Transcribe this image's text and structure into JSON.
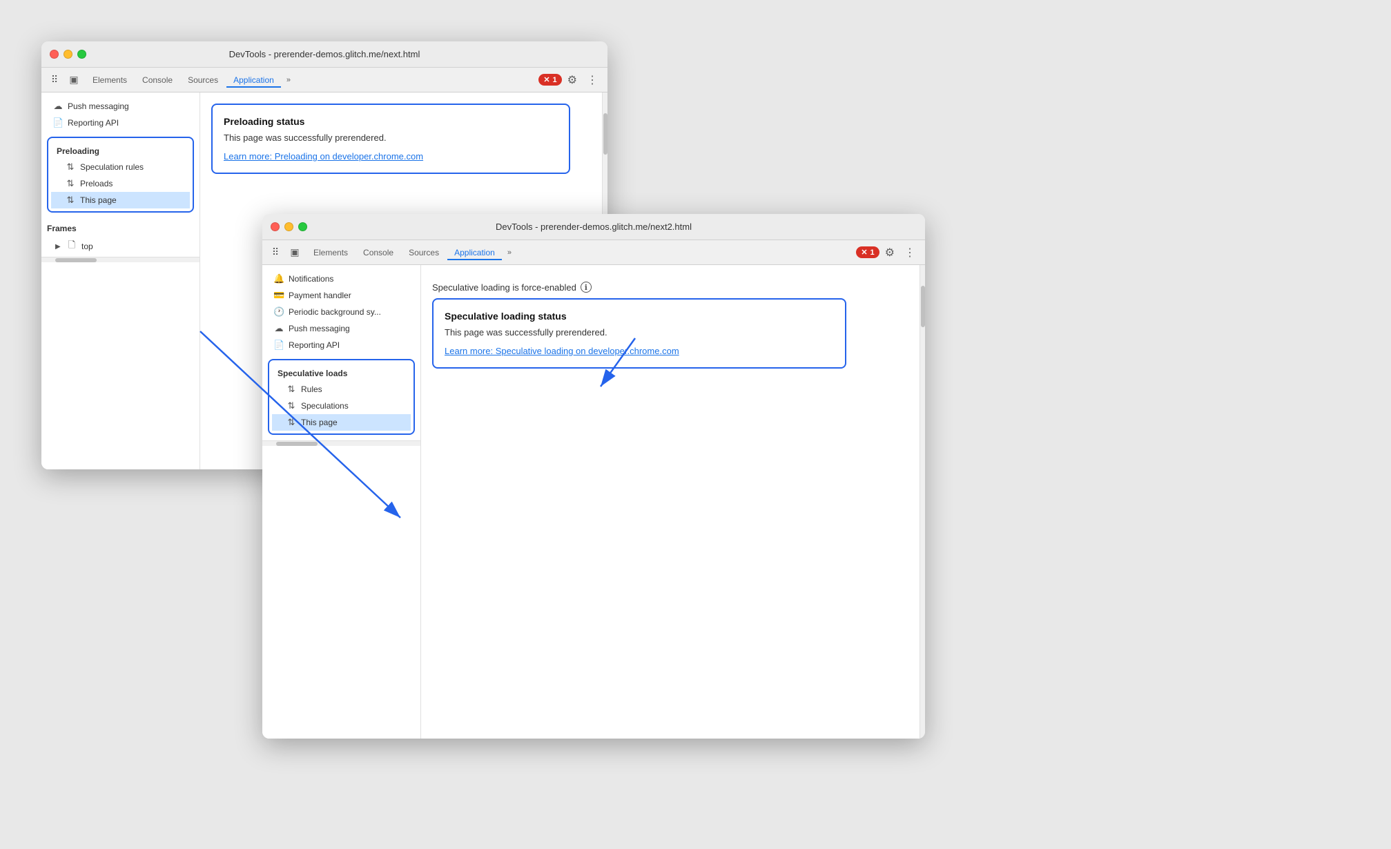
{
  "window1": {
    "title": "DevTools - prerender-demos.glitch.me/next.html",
    "tabs": [
      "Elements",
      "Console",
      "Sources",
      "Application"
    ],
    "active_tab": "Application",
    "error_count": "1",
    "sidebar": {
      "groups": [
        {
          "label": null,
          "items": [
            {
              "icon": "☁",
              "label": "Push messaging"
            },
            {
              "icon": "📄",
              "label": "Reporting API"
            }
          ]
        },
        {
          "label": "Preloading",
          "items": [
            {
              "icon": "↑↓",
              "label": "Speculation rules"
            },
            {
              "icon": "↑↓",
              "label": "Preloads"
            },
            {
              "icon": "↑↓",
              "label": "This page",
              "selected": true
            }
          ]
        },
        {
          "label": "Frames",
          "items": [
            {
              "icon": "▶",
              "label": "top",
              "indent": true
            }
          ]
        }
      ]
    },
    "main": {
      "box_title": "Preloading status",
      "box_text": "This page was successfully prerendered.",
      "box_link": "Learn more: Preloading on developer.chrome.com"
    }
  },
  "window2": {
    "title": "DevTools - prerender-demos.glitch.me/next2.html",
    "tabs": [
      "Elements",
      "Console",
      "Sources",
      "Application"
    ],
    "active_tab": "Application",
    "error_count": "1",
    "sidebar": {
      "items": [
        {
          "icon": "🔔",
          "label": "Notifications"
        },
        {
          "icon": "💳",
          "label": "Payment handler"
        },
        {
          "icon": "🕐",
          "label": "Periodic background sy..."
        },
        {
          "icon": "☁",
          "label": "Push messaging"
        },
        {
          "icon": "📄",
          "label": "Reporting API"
        }
      ],
      "speculative_group": {
        "label": "Speculative loads",
        "items": [
          {
            "icon": "↑↓",
            "label": "Rules"
          },
          {
            "icon": "↑↓",
            "label": "Speculations"
          },
          {
            "icon": "↑↓",
            "label": "This page",
            "selected": true
          }
        ]
      }
    },
    "main": {
      "force_enabled": "Speculative loading is force-enabled",
      "box_title": "Speculative loading status",
      "box_text": "This page was successfully prerendered.",
      "box_link": "Learn more: Speculative loading on developer.chrome.com"
    }
  },
  "icons": {
    "cursor": "⠿",
    "device": "⬜",
    "settings": "⚙",
    "more": "⋮",
    "chevron": "»"
  }
}
